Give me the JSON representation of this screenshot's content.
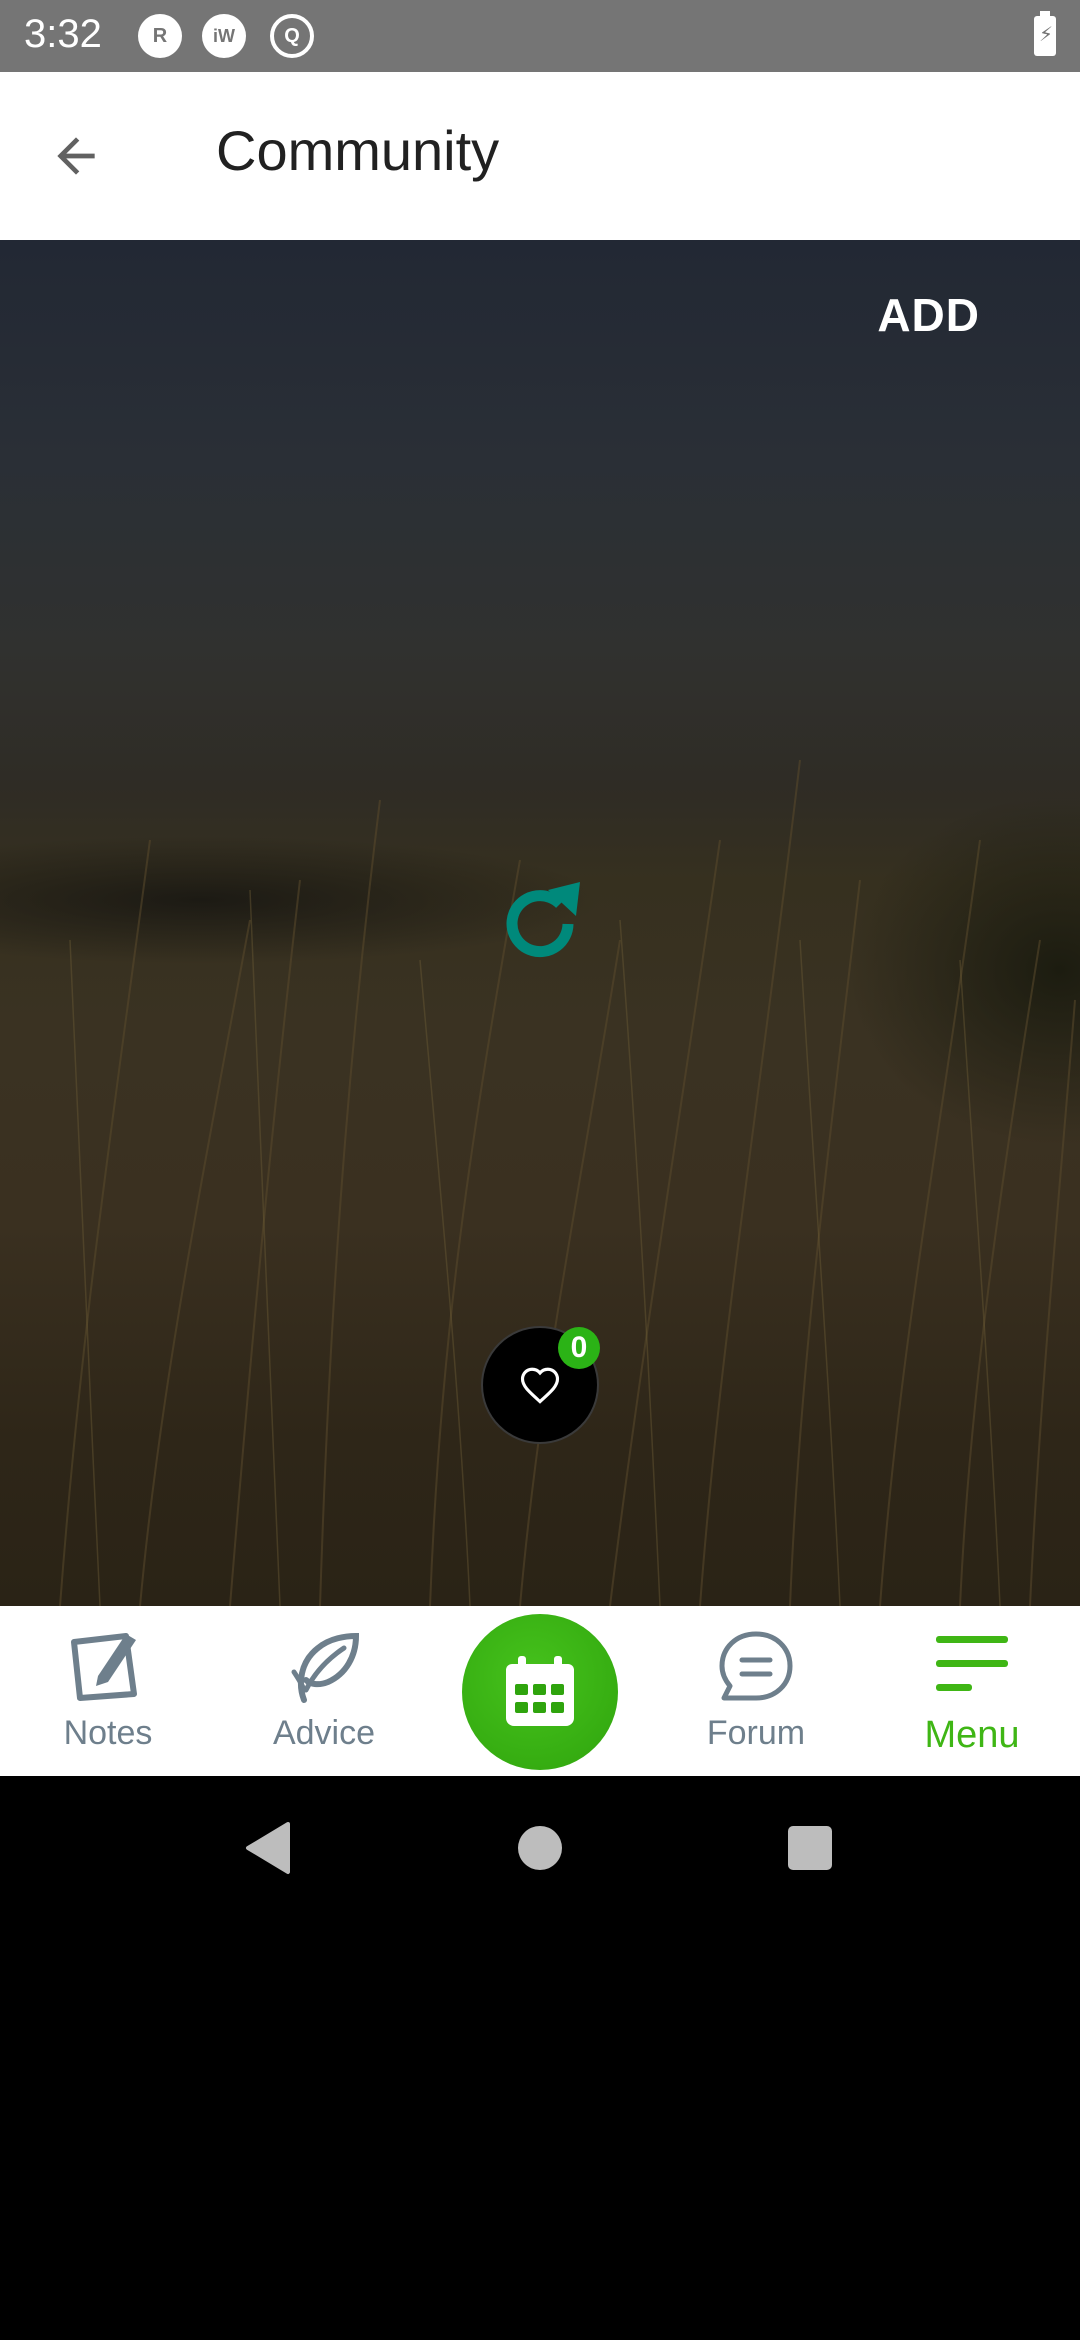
{
  "status_bar": {
    "time": "3:32",
    "icons": [
      {
        "name": "r-notification-icon",
        "glyph": "R"
      },
      {
        "name": "iw-notification-icon",
        "glyph": "iW"
      },
      {
        "name": "q-notification-icon",
        "glyph": "Q"
      }
    ],
    "battery_glyph": "⚡"
  },
  "app_bar": {
    "title": "Community",
    "back_icon": "arrow-left-icon"
  },
  "content": {
    "add_label": "ADD",
    "refresh_icon": "refresh-icon",
    "like_icon": "heart-icon",
    "like_count": "0"
  },
  "bottom_nav": {
    "items": [
      {
        "label": "Notes",
        "icon": "notes-icon",
        "active": false
      },
      {
        "label": "Advice",
        "icon": "leaf-icon",
        "active": false
      },
      {
        "label": "",
        "icon": "calendar-icon",
        "active": false
      },
      {
        "label": "Forum",
        "icon": "chat-bubble-icon",
        "active": false
      },
      {
        "label": "Menu",
        "icon": "menu-icon",
        "active": true
      }
    ]
  },
  "colors": {
    "accent_green": "#3fb615",
    "refresh_teal": "#00897b",
    "inactive_nav": "#6e7f8c"
  }
}
